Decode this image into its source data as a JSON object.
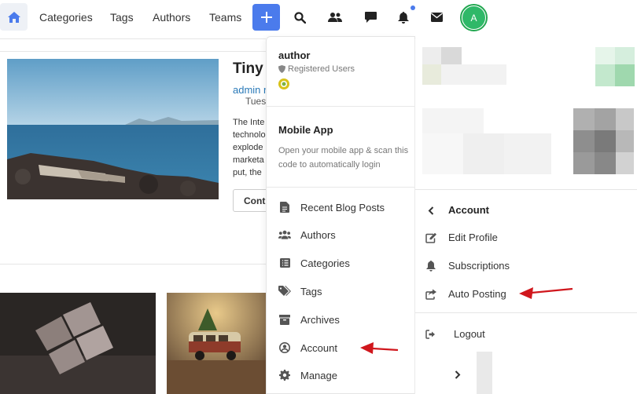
{
  "nav": {
    "links": [
      "Categories",
      "Tags",
      "Authors",
      "Teams"
    ],
    "avatar_letter": "A",
    "accent": "#4b7bec"
  },
  "post": {
    "title": "Tiny",
    "author": "admin r",
    "date": "Tues",
    "text_lines": [
      "The Inte",
      "technolo",
      "explode",
      "marketa",
      "put, the"
    ],
    "continue_label": "Conti"
  },
  "menu": {
    "username": "author",
    "role": "Registered Users",
    "mobile_title": "Mobile App",
    "mobile_desc": "Open your mobile app & scan this code to automatically login",
    "items": [
      {
        "label": "Recent Blog Posts",
        "icon": "document-icon"
      },
      {
        "label": "Authors",
        "icon": "users-icon"
      },
      {
        "label": "Categories",
        "icon": "list-icon"
      },
      {
        "label": "Tags",
        "icon": "tags-icon"
      },
      {
        "label": "Archives",
        "icon": "archive-icon"
      },
      {
        "label": "Account",
        "icon": "user-circle-icon"
      },
      {
        "label": "Manage",
        "icon": "gear-icon"
      }
    ]
  },
  "account_menu": {
    "title": "Account",
    "items": [
      {
        "label": "Edit Profile",
        "icon": "edit-icon"
      },
      {
        "label": "Subscriptions",
        "icon": "bell-icon"
      },
      {
        "label": "Auto Posting",
        "icon": "share-icon"
      }
    ],
    "logout_label": "Logout"
  },
  "annotation": {
    "arrow_color": "#d0171d"
  }
}
